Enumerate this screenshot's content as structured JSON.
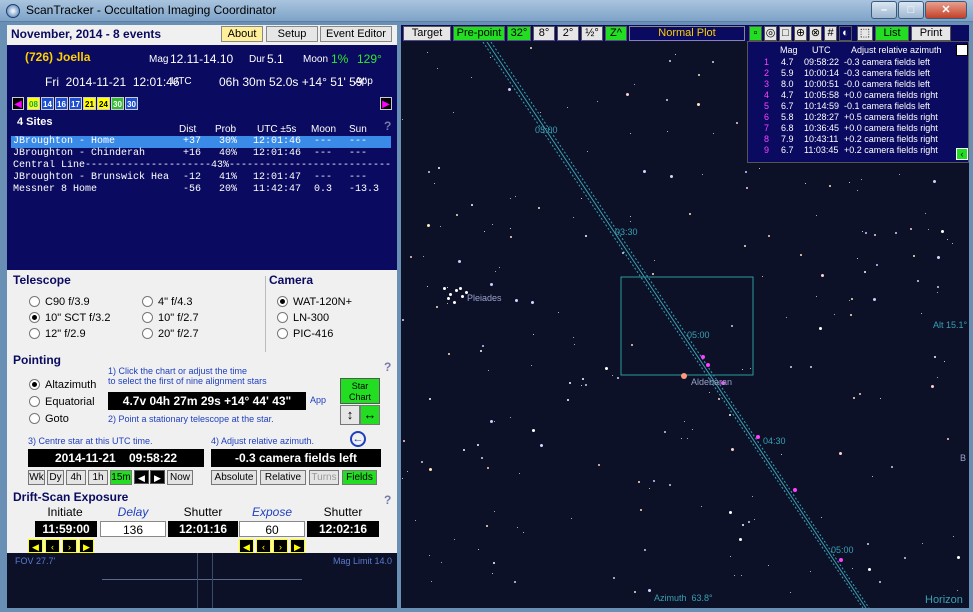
{
  "window": {
    "title": "ScanTracker - Occultation Imaging Coordinator"
  },
  "header": {
    "month_events": "November, 2014 - 8 events",
    "tabs": [
      "About",
      "Setup",
      "Event Editor"
    ],
    "event_name": "(726) Joella",
    "mag_label": "Mag",
    "mag_value": "12.11-14.10",
    "dur_label": "Dur",
    "dur_value": "5.1",
    "moon_label": "Moon",
    "moon_pct": "1%",
    "moon_angle": "129°",
    "date_line": "Fri  2014-11-21  12:01:46",
    "utc_label": "UTC",
    "countdown": "06h 30m 52.0s +14° 51' 59\"",
    "app_label": "App",
    "day_buttons": [
      "08",
      "14",
      "16",
      "17",
      "21",
      "24",
      "30",
      "30"
    ],
    "day_colors": [
      "#3a8a3a",
      "#1d4fd0",
      "#1d4fd0",
      "#1d4fd0",
      "#ffff00",
      "#ffff00",
      "#33bb33",
      "#1d4fd0"
    ]
  },
  "sites": {
    "title": "4 Sites",
    "columns": [
      "Dist",
      "Prob",
      "UTC ±5s",
      "Moon",
      "Sun"
    ],
    "rows": [
      {
        "name": "JBroughton - Home",
        "dist": "+37",
        "prob": "30%",
        "utc": "12:01:46",
        "moon": "---",
        "sun": "---"
      },
      {
        "name": "JBroughton - Chinderah",
        "dist": "+16",
        "prob": "40%",
        "utc": "12:01:46",
        "moon": "---",
        "sun": "---"
      },
      {
        "name": "JBroughton - Brunswick Hea",
        "dist": "-12",
        "prob": "41%",
        "utc": "12:01:47",
        "moon": "---",
        "sun": "---"
      },
      {
        "name": "Messner 8 Home",
        "dist": "-56",
        "prob": "20%",
        "utc": "11:42:47",
        "moon": "0.3",
        "sun": "-13.3"
      }
    ],
    "central_line": "Central Line---------------------43%----------------------------------------"
  },
  "telescope": {
    "title": "Telescope",
    "options": [
      "C90 f/3.9",
      "4\" f/4.3",
      "10\" SCT f/3.2",
      "10\" f/2.7",
      "12\" f/2.9",
      "20\" f/2.7"
    ]
  },
  "camera": {
    "title": "Camera",
    "options": [
      "WAT-120N+",
      "LN-300",
      "PIC-416"
    ]
  },
  "pointing": {
    "title": "Pointing",
    "modes": [
      "Altazimuth",
      "Equatorial",
      "Goto"
    ],
    "step1": "1) Click the chart or adjust the time",
    "step1b": "to select the first of nine alignment stars",
    "star_readout": "4.7v  04h 27m 29s  +14° 44' 43\"",
    "app_label": "App",
    "step2": "2) Point a stationary telescope at the star.",
    "star_chart_label": "Star Chart",
    "step3": "3) Centre star at this UTC time.",
    "utc_time": "2014-11-21    09:58:22",
    "step4": "4) Adjust relative azimuth.",
    "azimuth": "-0.3 camera fields left",
    "time_buttons": [
      "Wk",
      "Dy",
      "4h",
      "1h",
      "15m",
      "Now"
    ],
    "az_buttons": [
      "Absolute",
      "Relative",
      "Turns",
      "Fields"
    ]
  },
  "drift": {
    "title": "Drift-Scan Exposure",
    "labels": [
      "Initiate",
      "Delay",
      "Shutter Open",
      "Expose",
      "Shutter Close"
    ],
    "values": [
      "11:59:00",
      "136",
      "12:01:16",
      "60",
      "12:02:16"
    ]
  },
  "preview": {
    "fov": "FOV 27.7'",
    "mag_limit": "Mag Limit 14.0"
  },
  "chart": {
    "toolbar": [
      "Target",
      "Pre-point",
      "32°",
      "8°",
      "2°",
      "½°",
      "Z^"
    ],
    "plot_mode": "Normal  Plot",
    "right_buttons": [
      "List",
      "Print"
    ],
    "align_header": [
      "Mag",
      "UTC",
      "Adjust relative azimuth"
    ],
    "align_rows": [
      [
        "1",
        "4.7",
        "09:58:22",
        "-0.3 camera fields left"
      ],
      [
        "2",
        "5.9",
        "10:00:14",
        "-0.3 camera fields left"
      ],
      [
        "3",
        "8.0",
        "10:00:51",
        "-0.0 camera fields left"
      ],
      [
        "4",
        "4.7",
        "10:05:58",
        "+0.0 camera fields right"
      ],
      [
        "5",
        "6.7",
        "10:14:59",
        "-0.1 camera fields left"
      ],
      [
        "6",
        "5.8",
        "10:28:27",
        "+0.5 camera fields right"
      ],
      [
        "7",
        "6.8",
        "10:36:45",
        "+0.0 camera fields right"
      ],
      [
        "8",
        "7.9",
        "10:43:11",
        "+0.2 camera fields right"
      ],
      [
        "9",
        "6.7",
        "11:03:45",
        "+0.2 camera fields right"
      ]
    ],
    "labels": {
      "pleiades": "Pleiades",
      "aldebaran": "Aldebaran",
      "alt": "Alt 15.1°",
      "azimuth": "Azimuth  63.8°",
      "horizon": "Horizon",
      "b": "B",
      "t1": "03:00",
      "t2": "03:30",
      "t3": "05:00",
      "t4": "04:30",
      "t5": "05:00"
    }
  }
}
